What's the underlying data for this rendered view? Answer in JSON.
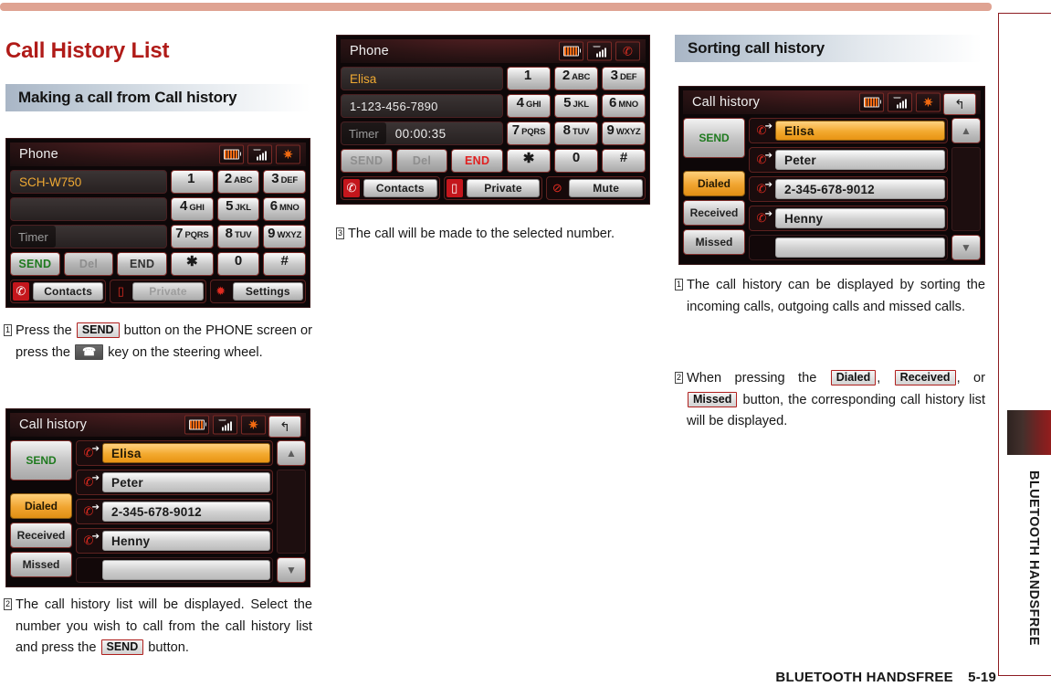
{
  "page": {
    "title": "Call History List",
    "footer_section": "BLUETOOTH HANDSFREE",
    "footer_page": "5-19",
    "side_tab_label": "BLUETOOTH HANDSFREE",
    "accent_red": "#b01b18",
    "top_rule_color": "#dfa392"
  },
  "sections": {
    "making_call": "Making a call from Call history",
    "sorting": "Sorting call history"
  },
  "phone_screen_1": {
    "title": "Phone",
    "status_icons": [
      "battery-icon",
      "signal-icon",
      "bluetooth-icon"
    ],
    "field_name": "SCH-W750",
    "field_number": "",
    "timer_label": "Timer",
    "timer_value": "",
    "actions": [
      {
        "label": "SEND",
        "state": "active"
      },
      {
        "label": "Del",
        "state": "disabled"
      },
      {
        "label": "END",
        "state": "normal"
      }
    ],
    "keys": [
      {
        "digit": "1",
        "letters": ""
      },
      {
        "digit": "2",
        "letters": "ABC"
      },
      {
        "digit": "3",
        "letters": "DEF"
      },
      {
        "digit": "4",
        "letters": "GHI"
      },
      {
        "digit": "5",
        "letters": "JKL"
      },
      {
        "digit": "6",
        "letters": "MNO"
      },
      {
        "digit": "7",
        "letters": "PQRS"
      },
      {
        "digit": "8",
        "letters": "TUV"
      },
      {
        "digit": "9",
        "letters": "WXYZ"
      },
      {
        "digit": "✱",
        "letters": ""
      },
      {
        "digit": "0",
        "letters": ""
      },
      {
        "digit": "#",
        "letters": ""
      }
    ],
    "bottom": [
      {
        "icon": "handset-icon",
        "label": "Contacts",
        "state": "normal"
      },
      {
        "icon": "cellphone-icon",
        "label": "Private",
        "state": "disabled"
      },
      {
        "icon": "gear-icon",
        "label": "Settings",
        "state": "normal"
      }
    ]
  },
  "phone_screen_2": {
    "title": "Phone",
    "status_icons": [
      "battery-icon",
      "signal-icon",
      "handset-icon"
    ],
    "field_name": "Elisa",
    "field_number": "1-123-456-7890",
    "timer_label": "Timer",
    "timer_value": "00:00:35",
    "actions": [
      {
        "label": "SEND",
        "state": "disabled"
      },
      {
        "label": "Del",
        "state": "disabled"
      },
      {
        "label": "END",
        "state": "end-active"
      }
    ],
    "keys": [
      {
        "digit": "1",
        "letters": ""
      },
      {
        "digit": "2",
        "letters": "ABC"
      },
      {
        "digit": "3",
        "letters": "DEF"
      },
      {
        "digit": "4",
        "letters": "GHI"
      },
      {
        "digit": "5",
        "letters": "JKL"
      },
      {
        "digit": "6",
        "letters": "MNO"
      },
      {
        "digit": "7",
        "letters": "PQRS"
      },
      {
        "digit": "8",
        "letters": "TUV"
      },
      {
        "digit": "9",
        "letters": "WXYZ"
      },
      {
        "digit": "✱",
        "letters": ""
      },
      {
        "digit": "0",
        "letters": ""
      },
      {
        "digit": "#",
        "letters": ""
      }
    ],
    "bottom": [
      {
        "icon": "handset-icon",
        "label": "Contacts",
        "state": "normal"
      },
      {
        "icon": "cellphone-icon",
        "label": "Private",
        "state": "normal"
      },
      {
        "icon": "mute-icon",
        "label": "Mute",
        "state": "normal"
      }
    ]
  },
  "call_history_screen": {
    "title": "Call history",
    "status_icons": [
      "battery-icon",
      "signal-icon",
      "bluetooth-icon"
    ],
    "back_icon": "back-arrow-icon",
    "filters": [
      {
        "label": "SEND",
        "state": "send"
      },
      {
        "label": "Dialed",
        "state": "selected"
      },
      {
        "label": "Received",
        "state": "normal"
      },
      {
        "label": "Missed",
        "state": "normal"
      }
    ],
    "entries": [
      {
        "text": "Elisa",
        "selected": true,
        "icon": "outgoing-call-icon"
      },
      {
        "text": "Peter",
        "selected": false,
        "icon": "outgoing-call-icon"
      },
      {
        "text": "2-345-678-9012",
        "selected": false,
        "icon": "outgoing-call-icon"
      },
      {
        "text": "Henny",
        "selected": false,
        "icon": "outgoing-call-icon"
      },
      {
        "text": "",
        "selected": false,
        "icon": ""
      }
    ],
    "scroll_up": "scroll-up-icon",
    "scroll_down": "scroll-down-icon"
  },
  "steps": {
    "col_a_1_pre": "Press the ",
    "col_a_1_kbd": "SEND",
    "col_a_1_mid": " button on the PHONE screen or press the ",
    "col_a_1_key_icon": "☎",
    "col_a_1_post": " key on the steering wheel.",
    "col_a_1_num": "1",
    "col_a_2_num": "2",
    "col_a_2_pre": "The call history list will be displayed. Select the number you wish to call from the call history list and press the ",
    "col_a_2_kbd": "SEND",
    "col_a_2_post": " button.",
    "col_b_3_num": "3",
    "col_b_3_text": "The call will be made to the selected number.",
    "col_c_1_num": "1",
    "col_c_1_text": "The call history can be displayed by sorting the incoming calls, outgoing calls and missed calls.",
    "col_c_2_num": "2",
    "col_c_2_pre": "When pressing the ",
    "col_c_2_kbd1": "Dialed",
    "col_c_2_sep1": ", ",
    "col_c_2_kbd2": "Received",
    "col_c_2_sep2": ", or ",
    "col_c_2_kbd3": "Missed",
    "col_c_2_post": " button, the corresponding call history list will be displayed."
  }
}
